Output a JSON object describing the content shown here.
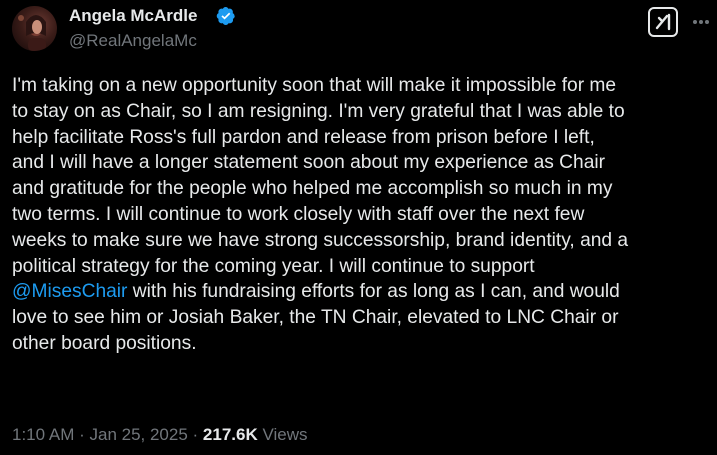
{
  "author": {
    "name": "Angela McArdle",
    "handle": "@RealAngelaMc"
  },
  "tweet": {
    "lines": [
      "I'm taking on a new opportunity soon that will make it impossible for me",
      "to stay on as Chair, so I am resigning. I'm very grateful that I was able to",
      "help facilitate Ross's full pardon and release from prison before I left,",
      "and I will have a longer statement soon about my experience as Chair",
      "and gratitude for the people who helped me accomplish so much in my",
      "two terms. I will continue to work closely with staff over the next few",
      "weeks to make sure we have strong successorship, brand identity, and a",
      "political strategy for the coming year. I will continue to support"
    ],
    "mention_line": {
      "mention": "@MisesChair",
      "rest": " with his fundraising efforts for as long as I can, and would"
    },
    "tail_lines": [
      "love to see him or Josiah Baker, the TN Chair, elevated to LNC Chair or",
      "other board positions."
    ]
  },
  "meta": {
    "time": "1:10 AM",
    "separator": " · ",
    "date": "Jan 25, 2025",
    "views_count": "217.6K",
    "views_label": " Views"
  },
  "icons": {
    "verified": "verified-badge-icon",
    "grok": "grok-icon",
    "more": "more-icon"
  },
  "colors": {
    "background": "#000000",
    "text": "#e7e9ea",
    "secondary": "#71767b",
    "accent": "#1d9bf0"
  }
}
